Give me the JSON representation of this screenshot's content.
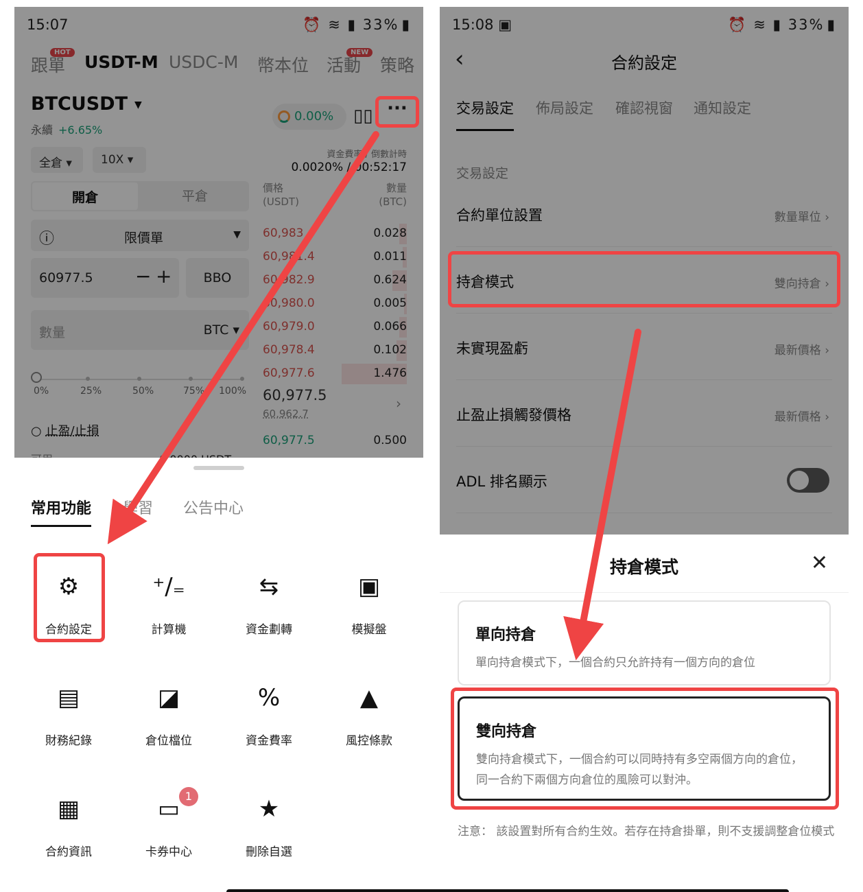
{
  "left": {
    "status": {
      "time": "15:07",
      "battery": "33%"
    },
    "top_tabs": [
      {
        "label": "跟單",
        "badge": "HOT"
      },
      {
        "label": "USDT-M",
        "badge": ""
      },
      {
        "label": "USDC-M",
        "badge": ""
      },
      {
        "label": "幣本位",
        "badge": ""
      },
      {
        "label": "活動",
        "badge": "NEW"
      },
      {
        "label": "策略",
        "badge": ""
      }
    ],
    "pair": "BTCUSDT",
    "pair_type": "永續",
    "pair_change": "+6.65%",
    "rate_chip": "0.00%",
    "margin_mode": "全倉",
    "leverage": "10X",
    "funding_label": "資金費率 / 倒數計時",
    "funding_value": "0.0020% / 00:52:17",
    "order_tabs": [
      "開倉",
      "平倉"
    ],
    "order_type": "限價單",
    "price_value": "60977.5",
    "bbo_label": "BBO",
    "qty_placeholder": "數量",
    "qty_unit": "BTC",
    "price_header": "價格\n(USDT)",
    "qty_header": "數量\n(BTC)",
    "orderbook": [
      {
        "price": "60,983",
        "qty": "0.028",
        "depth": 0.05
      },
      {
        "price": "60,981.4",
        "qty": "0.011",
        "depth": 0.03
      },
      {
        "price": "60,982.9",
        "qty": "0.624",
        "depth": 0.1
      },
      {
        "price": "60,980.0",
        "qty": "0.005",
        "depth": 0.02
      },
      {
        "price": "60,979.0",
        "qty": "0.066",
        "depth": 0.05
      },
      {
        "price": "60,978.4",
        "qty": "0.102",
        "depth": 0.07
      },
      {
        "price": "60,977.6",
        "qty": "1.476",
        "depth": 0.45
      }
    ],
    "last_price": "60,977.5",
    "mark_price": "60,962.7",
    "bid_row": {
      "price": "60,977.5",
      "qty": "0.500"
    },
    "percent_labels": [
      "0%",
      "25%",
      "50%",
      "75%",
      "100%"
    ],
    "tp_sl_label": "止盈/止損",
    "available_label": "可用",
    "available_value": "0.0000 USDT",
    "sheet_tabs": [
      "常用功能",
      "學習",
      "公告中心"
    ],
    "grid": [
      {
        "label": "合約設定",
        "icon": "gear-icon",
        "glyph": "⚙",
        "badge": ""
      },
      {
        "label": "計算機",
        "icon": "calculator-icon",
        "glyph": "⁺∕₌",
        "badge": ""
      },
      {
        "label": "資金劃轉",
        "icon": "transfer-icon",
        "glyph": "⇆",
        "badge": ""
      },
      {
        "label": "模擬盤",
        "icon": "simulation-icon",
        "glyph": "▣",
        "badge": ""
      },
      {
        "label": "財務紀錄",
        "icon": "finance-record-icon",
        "glyph": "▤",
        "badge": ""
      },
      {
        "label": "倉位檔位",
        "icon": "position-tier-icon",
        "glyph": "◪",
        "badge": ""
      },
      {
        "label": "資金費率",
        "icon": "funding-rate-icon",
        "glyph": "%",
        "badge": ""
      },
      {
        "label": "風控條款",
        "icon": "risk-warning-icon",
        "glyph": "▲",
        "badge": ""
      },
      {
        "label": "合約資訊",
        "icon": "contract-info-icon",
        "glyph": "▦",
        "badge": ""
      },
      {
        "label": "卡券中心",
        "icon": "coupon-icon",
        "glyph": "▭",
        "badge": "1"
      },
      {
        "label": "刪除自選",
        "icon": "star-icon",
        "glyph": "★",
        "badge": ""
      }
    ]
  },
  "right": {
    "status": {
      "time": "15:08",
      "battery": "33%"
    },
    "title": "合約設定",
    "tabs": [
      "交易設定",
      "佈局設定",
      "確認視窗",
      "通知設定"
    ],
    "section": "交易設定",
    "rows": [
      {
        "name": "合約單位設置",
        "value": "數量單位"
      },
      {
        "name": "持倉模式",
        "value": "雙向持倉"
      },
      {
        "name": "未實現盈虧",
        "value": "最新價格"
      },
      {
        "name": "止盈止損觸發價格",
        "value": "最新價格"
      },
      {
        "name": "ADL 排名顯示",
        "value": ""
      }
    ],
    "sheet_title": "持倉模式",
    "options": [
      {
        "title": "單向持倉",
        "desc": "單向持倉模式下，一個合約只允許持有一個方向的倉位"
      },
      {
        "title": "雙向持倉",
        "desc": "雙向持倉模式下，一個合約可以同時持有多空兩個方向的倉位，同一合約下兩個方向倉位的風險可以對沖。"
      }
    ],
    "note": "注意： 該設置對所有合約生效。若存在持倉掛單，則不支援調整倉位模式"
  },
  "colors": {
    "highlight": "#ef4444",
    "ask": "#d9534f",
    "up": "#1ba27a"
  }
}
